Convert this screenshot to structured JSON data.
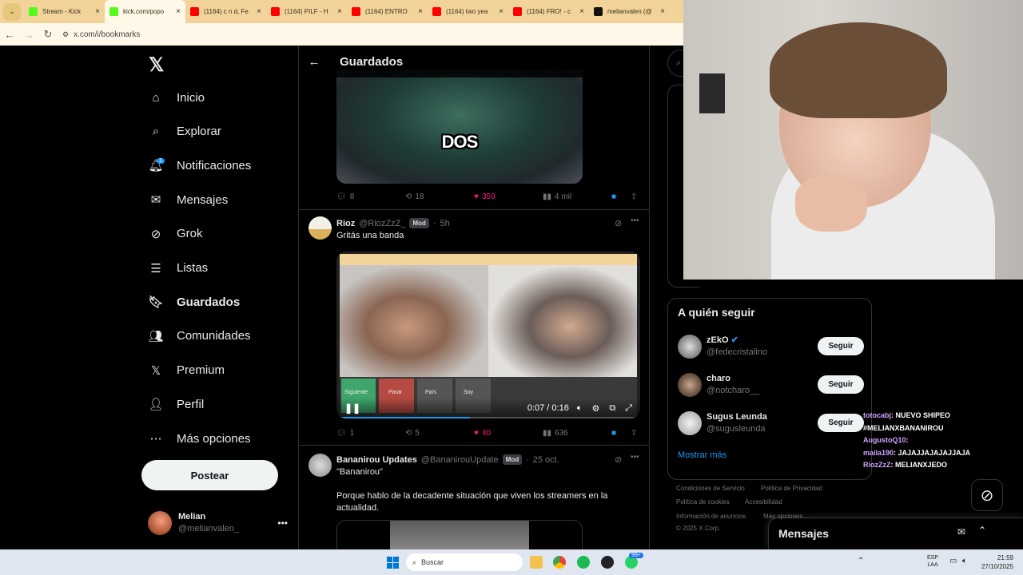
{
  "browser": {
    "tabs": [
      {
        "title": "Stream - Kick",
        "color": "#53fc18",
        "active": false
      },
      {
        "title": "kick.com/popo",
        "color": "#53fc18",
        "active": true
      },
      {
        "title": "(1164) c n d, Fe",
        "color": "#ff0000",
        "active": false
      },
      {
        "title": "(1164) PILF - H",
        "color": "#ff0000",
        "active": false
      },
      {
        "title": "(1164) ENTRO",
        "color": "#ff0000",
        "active": false
      },
      {
        "title": "(1164) two yea",
        "color": "#ff0000",
        "active": false
      },
      {
        "title": "(1164) FRO! - c",
        "color": "#ff0000",
        "active": false
      },
      {
        "title": "melianvalen (@",
        "color": "#111111",
        "active": false
      }
    ],
    "url": "x.com/i/bookmarks"
  },
  "sidebar": {
    "nav": [
      {
        "label": "Inicio",
        "icon": "home-icon"
      },
      {
        "label": "Explorar",
        "icon": "search-icon"
      },
      {
        "label": "Notificaciones",
        "icon": "bell-icon",
        "badge": "1"
      },
      {
        "label": "Mensajes",
        "icon": "mail-icon"
      },
      {
        "label": "Grok",
        "icon": "grok-icon"
      },
      {
        "label": "Listas",
        "icon": "list-icon"
      },
      {
        "label": "Guardados",
        "icon": "bookmark-icon",
        "active": true
      },
      {
        "label": "Comunidades",
        "icon": "people-icon"
      },
      {
        "label": "Premium",
        "icon": "x-logo-icon"
      },
      {
        "label": "Perfil",
        "icon": "person-icon"
      },
      {
        "label": "Más opciones",
        "icon": "more-circle-icon"
      }
    ],
    "post_label": "Postear",
    "user": {
      "name": "Melian",
      "handle": "@melianvalen_"
    }
  },
  "main": {
    "title": "Guardados",
    "tweet0": {
      "video_text": "DOS",
      "replies": "8",
      "reposts": "18",
      "likes": "359",
      "views": "4 mil"
    },
    "tweet1": {
      "name": "Rioz",
      "handle": "@RiozZzZ_",
      "badge": "Mod",
      "time": "5h",
      "text": "Gritás una banda",
      "video_time": "0:07 / 0:16",
      "buttons": [
        "Siguiente",
        "Parar",
        "País",
        "Soy"
      ],
      "replies": "1",
      "reposts": "5",
      "likes": "40",
      "views": "636"
    },
    "tweet2": {
      "name": "Bananirou Updates",
      "handle": "@BananirouUpdate",
      "badge": "Mod",
      "time": "25 oct.",
      "quote": "\"Bananirou\"",
      "text": "Porque hablo de la decadente situación que viven los streamers en la actualidad."
    }
  },
  "right": {
    "who_to_follow_title": "A quién seguir",
    "follow_label": "Seguir",
    "suggestions": [
      {
        "name": "zEkO",
        "handle": "@fedecristalino",
        "verified": true
      },
      {
        "name": "charo",
        "handle": "@notcharo__",
        "verified": false
      },
      {
        "name": "Sugus Leunda",
        "handle": "@sugusleunda",
        "verified": false
      }
    ],
    "show_more": "Mostrar más",
    "footer": [
      "Condiciones de Servicio",
      "Política de Privacidad",
      "Política de cookies",
      "Accesibilidad",
      "Información de anuncios",
      "Más opciones ...",
      "© 2025 X Corp."
    ],
    "messages_label": "Mensajes"
  },
  "chat": [
    {
      "user": "totocabj",
      "msg": ": NUEVO SHIPEO"
    },
    {
      "user": "",
      "msg": "#MELIANXBANANIROU"
    },
    {
      "user": "AugustoQ10",
      "msg": ": "
    },
    {
      "user": "maila190",
      "msg": ": JAJAJJAJAJAJJAJA"
    },
    {
      "user": "RiozZzZ",
      "msg": ": MELIANXJEDO"
    }
  ],
  "taskbar": {
    "search": "Buscar",
    "lang": "ESP",
    "lang2": "LAA",
    "time": "21:59",
    "date": "27/10/2025",
    "badge": "99+"
  }
}
